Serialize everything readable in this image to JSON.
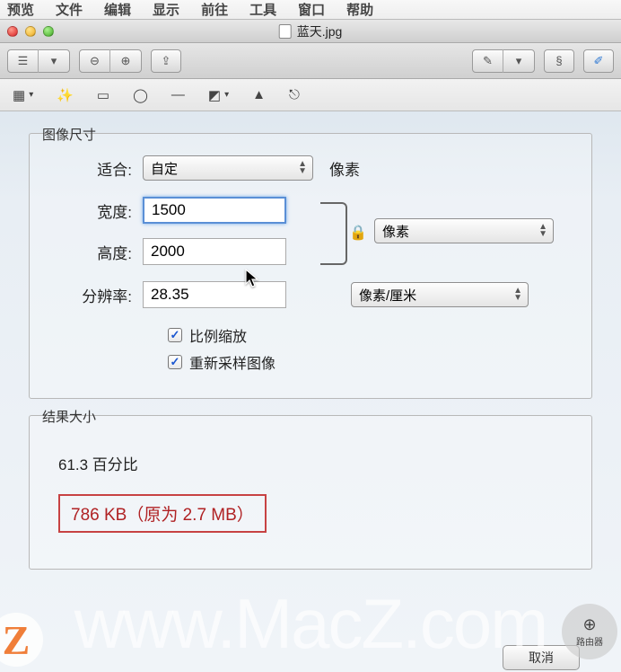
{
  "menubar": {
    "items": [
      "预览",
      "文件",
      "编辑",
      "显示",
      "前往",
      "工具",
      "窗口",
      "帮助"
    ]
  },
  "window": {
    "title": "蓝天.jpg"
  },
  "toolbar": {
    "view_mode_1": "list-view",
    "view_mode_2": "cover-view",
    "zoom_out": "−",
    "zoom_in": "+",
    "share": "↗",
    "highlighter": "highlighter",
    "markup1": "sign",
    "markup2": "annotate",
    "edit": "edit"
  },
  "toolstrip": {
    "selection": "selection",
    "magic": "magic-wand",
    "rect": "rectangle",
    "ellipse": "ellipse",
    "line": "line",
    "shapes": "shapes",
    "mask": "mask",
    "adjust": "adjust",
    "crop": "crop"
  },
  "dialog": {
    "image_size_legend": "图像尺寸",
    "fit_label": "适合:",
    "fit_value": "自定",
    "fit_after": "像素",
    "width_label": "宽度:",
    "width_value": "1500",
    "height_label": "高度:",
    "height_value": "2000",
    "dimension_unit": "像素",
    "resolution_label": "分辨率:",
    "resolution_value": "28.35",
    "resolution_unit": "像素/厘米",
    "scale_proportional": "比例缩放",
    "resample": "重新采样图像",
    "result_legend": "结果大小",
    "result_percent": "61.3 百分比",
    "result_size": "786 KB（原为 2.7 MB）",
    "cancel": "取消"
  },
  "watermark": "www.MacZ.com",
  "watermark_logo": "Z",
  "watermark_right": "路由器"
}
